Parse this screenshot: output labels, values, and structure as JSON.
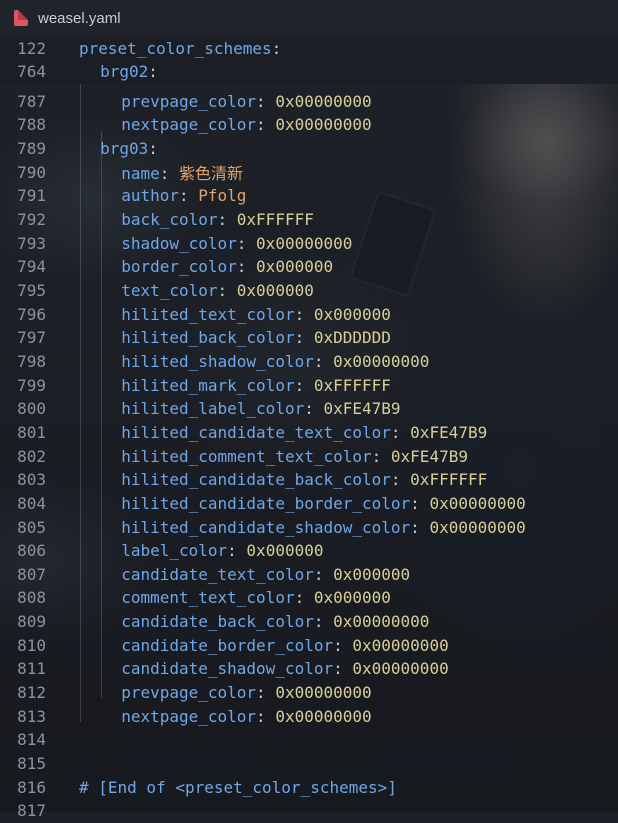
{
  "tab": {
    "title": "weasel.yaml",
    "icon": "yaml-file-icon"
  },
  "sticky": [
    {
      "ln": "122",
      "indent": 0,
      "key": "preset_color_schemes",
      "sep": ":",
      "value": "",
      "vtype": ""
    },
    {
      "ln": "764",
      "indent": 1,
      "key": "brg02",
      "sep": ":",
      "value": "",
      "vtype": ""
    }
  ],
  "lines": [
    {
      "ln": "787",
      "indent": 2,
      "key": "prevpage_color",
      "sep": ": ",
      "value": "0x00000000",
      "vtype": "num"
    },
    {
      "ln": "788",
      "indent": 2,
      "key": "nextpage_color",
      "sep": ": ",
      "value": "0x00000000",
      "vtype": "num"
    },
    {
      "ln": "789",
      "indent": 1,
      "key": "brg03",
      "sep": ":",
      "value": "",
      "vtype": ""
    },
    {
      "ln": "790",
      "indent": 2,
      "key": "name",
      "sep": ": ",
      "value": "紫色清新",
      "vtype": "str"
    },
    {
      "ln": "791",
      "indent": 2,
      "key": "author",
      "sep": ": ",
      "value": "Pfolg",
      "vtype": "str"
    },
    {
      "ln": "792",
      "indent": 2,
      "key": "back_color",
      "sep": ": ",
      "value": "0xFFFFFF",
      "vtype": "num"
    },
    {
      "ln": "793",
      "indent": 2,
      "key": "shadow_color",
      "sep": ": ",
      "value": "0x00000000",
      "vtype": "num"
    },
    {
      "ln": "794",
      "indent": 2,
      "key": "border_color",
      "sep": ": ",
      "value": "0x000000",
      "vtype": "num"
    },
    {
      "ln": "795",
      "indent": 2,
      "key": "text_color",
      "sep": ": ",
      "value": "0x000000",
      "vtype": "num"
    },
    {
      "ln": "796",
      "indent": 2,
      "key": "hilited_text_color",
      "sep": ": ",
      "value": "0x000000",
      "vtype": "num"
    },
    {
      "ln": "797",
      "indent": 2,
      "key": "hilited_back_color",
      "sep": ": ",
      "value": "0xDDDDDD",
      "vtype": "num"
    },
    {
      "ln": "798",
      "indent": 2,
      "key": "hilited_shadow_color",
      "sep": ": ",
      "value": "0x00000000",
      "vtype": "num"
    },
    {
      "ln": "799",
      "indent": 2,
      "key": "hilited_mark_color",
      "sep": ": ",
      "value": "0xFFFFFF",
      "vtype": "num"
    },
    {
      "ln": "800",
      "indent": 2,
      "key": "hilited_label_color",
      "sep": ": ",
      "value": "0xFE47B9",
      "vtype": "num"
    },
    {
      "ln": "801",
      "indent": 2,
      "key": "hilited_candidate_text_color",
      "sep": ": ",
      "value": "0xFE47B9",
      "vtype": "num"
    },
    {
      "ln": "802",
      "indent": 2,
      "key": "hilited_comment_text_color",
      "sep": ": ",
      "value": "0xFE47B9",
      "vtype": "num"
    },
    {
      "ln": "803",
      "indent": 2,
      "key": "hilited_candidate_back_color",
      "sep": ": ",
      "value": "0xFFFFFF",
      "vtype": "num"
    },
    {
      "ln": "804",
      "indent": 2,
      "key": "hilited_candidate_border_color",
      "sep": ": ",
      "value": "0x00000000",
      "vtype": "num"
    },
    {
      "ln": "805",
      "indent": 2,
      "key": "hilited_candidate_shadow_color",
      "sep": ": ",
      "value": "0x00000000",
      "vtype": "num"
    },
    {
      "ln": "806",
      "indent": 2,
      "key": "label_color",
      "sep": ": ",
      "value": "0x000000",
      "vtype": "num"
    },
    {
      "ln": "807",
      "indent": 2,
      "key": "candidate_text_color",
      "sep": ": ",
      "value": "0x000000",
      "vtype": "num"
    },
    {
      "ln": "808",
      "indent": 2,
      "key": "comment_text_color",
      "sep": ": ",
      "value": "0x000000",
      "vtype": "num"
    },
    {
      "ln": "809",
      "indent": 2,
      "key": "candidate_back_color",
      "sep": ": ",
      "value": "0x00000000",
      "vtype": "num"
    },
    {
      "ln": "810",
      "indent": 2,
      "key": "candidate_border_color",
      "sep": ": ",
      "value": "0x00000000",
      "vtype": "num"
    },
    {
      "ln": "811",
      "indent": 2,
      "key": "candidate_shadow_color",
      "sep": ": ",
      "value": "0x00000000",
      "vtype": "num"
    },
    {
      "ln": "812",
      "indent": 2,
      "key": "prevpage_color",
      "sep": ": ",
      "value": "0x00000000",
      "vtype": "num"
    },
    {
      "ln": "813",
      "indent": 2,
      "key": "nextpage_color",
      "sep": ": ",
      "value": "0x00000000",
      "vtype": "num"
    },
    {
      "ln": "814",
      "indent": 0,
      "key": "",
      "sep": "",
      "value": "",
      "vtype": ""
    },
    {
      "ln": "815",
      "indent": 0,
      "key": "",
      "sep": "",
      "value": "",
      "vtype": ""
    },
    {
      "ln": "816",
      "indent": 0,
      "key": "",
      "sep": "",
      "value": "# [End of <preset_color_schemes>]",
      "vtype": "cmt"
    },
    {
      "ln": "817",
      "indent": 0,
      "key": "",
      "sep": "",
      "value": "",
      "vtype": ""
    }
  ],
  "colors": {
    "key": "#6fa7e8",
    "number": "#d6cf9a",
    "string": "#e0a36a",
    "comment": "#6fa7e8",
    "line_number": "#8c93a0"
  }
}
